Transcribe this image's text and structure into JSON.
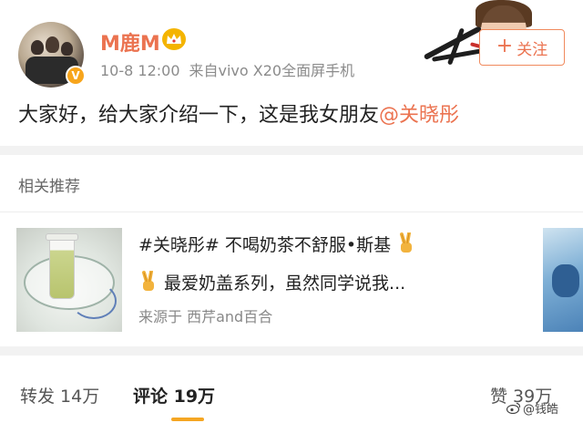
{
  "post": {
    "username": "M鹿M",
    "time": "10-8 12:00",
    "source": "来自vivo X20全面屏手机",
    "follow_label": "关注",
    "follow_plus": "+",
    "text": "大家好，给大家介绍一下，这是我女朋友",
    "mention": "@关晓彤",
    "verified_badge": "V"
  },
  "icons": {
    "avatar": "avatar-photo",
    "verified": "verified-badge-icon",
    "vip": "crown-icon",
    "banner": "celebrity-banner-image",
    "emoji": "victory-hand-emoji",
    "watermark": "weibo-logo-icon"
  },
  "related": {
    "title": "相关推荐",
    "card": {
      "line1": "#关晓彤# 不喝奶茶不舒服•斯基",
      "line2": "最爱奶盖系列，虽然同学说我...",
      "source_prefix": "来源于",
      "source": "西芹and百合"
    }
  },
  "tabs": {
    "repost": "转发 14万",
    "comment": "评论 19万",
    "like": "赞 39万",
    "active": "comment"
  },
  "watermark": {
    "text": "@钱皓"
  },
  "colors": {
    "accent": "#eb7350",
    "tab_indicator": "#f5a623",
    "separator": "#f2f2f2",
    "verified": "#f7a51c"
  }
}
